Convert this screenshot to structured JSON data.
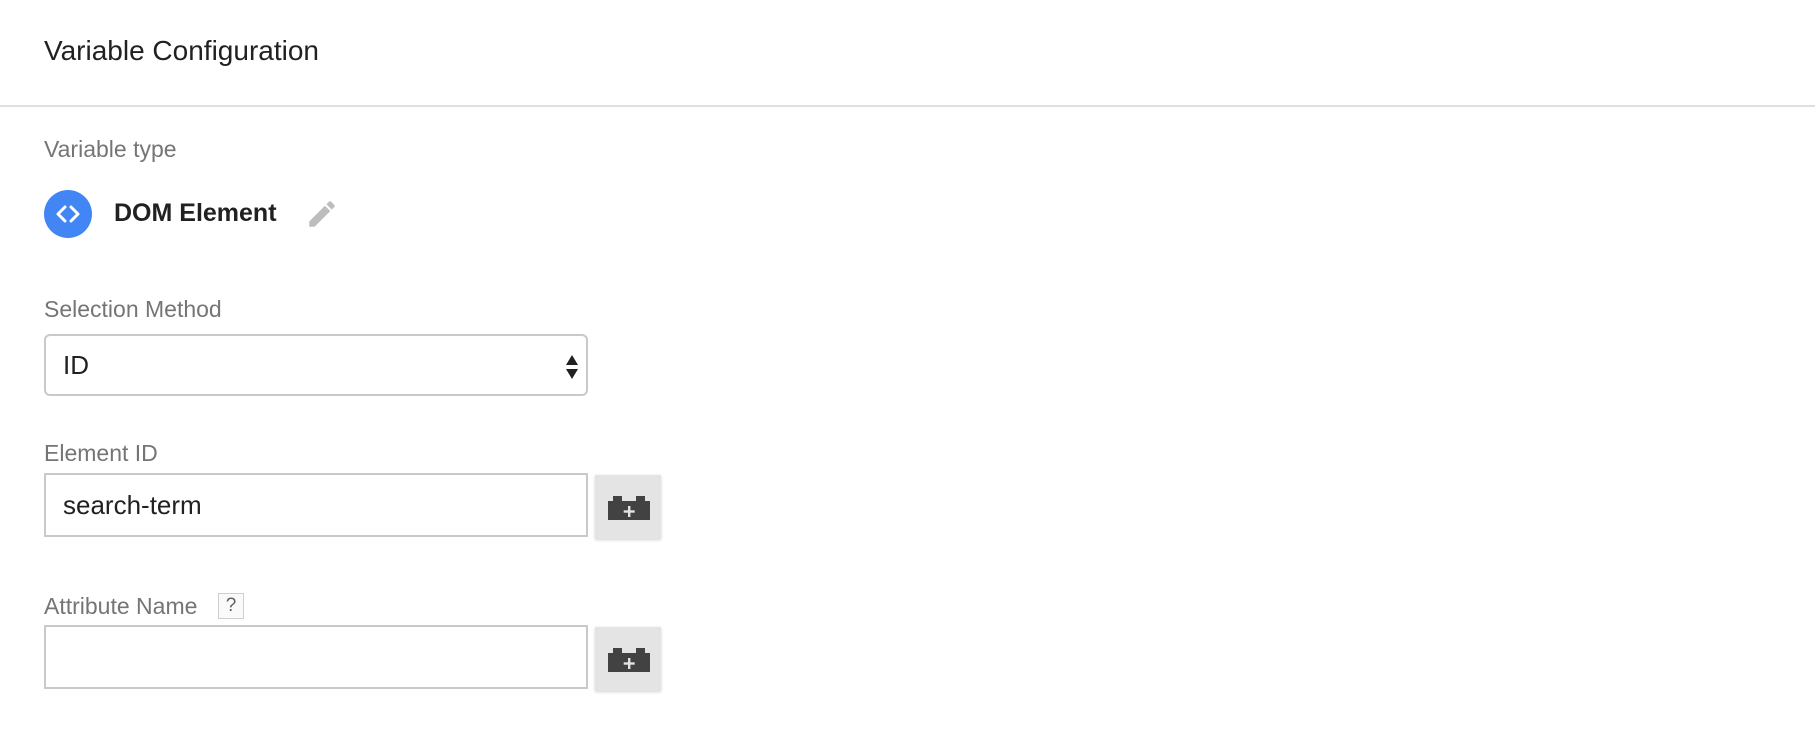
{
  "header": {
    "title": "Variable Configuration"
  },
  "variable_type": {
    "label": "Variable type",
    "name": "DOM Element",
    "icon": "code-brackets-icon",
    "icon_color": "#4285f4"
  },
  "selection_method": {
    "label": "Selection Method",
    "selected": "ID"
  },
  "element_id": {
    "label": "Element ID",
    "value": "search-term"
  },
  "attribute_name": {
    "label": "Attribute Name",
    "help": "?",
    "value": ""
  }
}
